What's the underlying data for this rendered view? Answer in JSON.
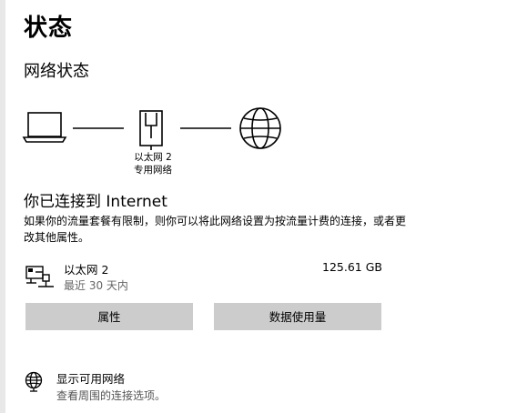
{
  "page": {
    "title": "状态"
  },
  "network_status": {
    "section_title": "网络状态",
    "diagram": {
      "device_icon": "laptop-icon",
      "adapter_icon": "ethernet-port-icon",
      "internet_icon": "globe-icon",
      "adapter_name": "以太网 2",
      "adapter_network": "专用网络"
    },
    "connected_heading": "你已连接到 Internet",
    "description": "如果你的流量套餐有限制，则你可以将此网络设置为按流量计费的连接，或者更改其他属性。"
  },
  "adapter": {
    "icon": "ethernet-pc-icon",
    "name": "以太网 2",
    "period": "最近 30 天内",
    "usage": "125.61 GB"
  },
  "buttons": {
    "properties": "属性",
    "data_usage": "数据使用量"
  },
  "show_networks": {
    "icon": "globe-icon",
    "title": "显示可用网络",
    "subtitle": "查看周围的连接选项。"
  }
}
